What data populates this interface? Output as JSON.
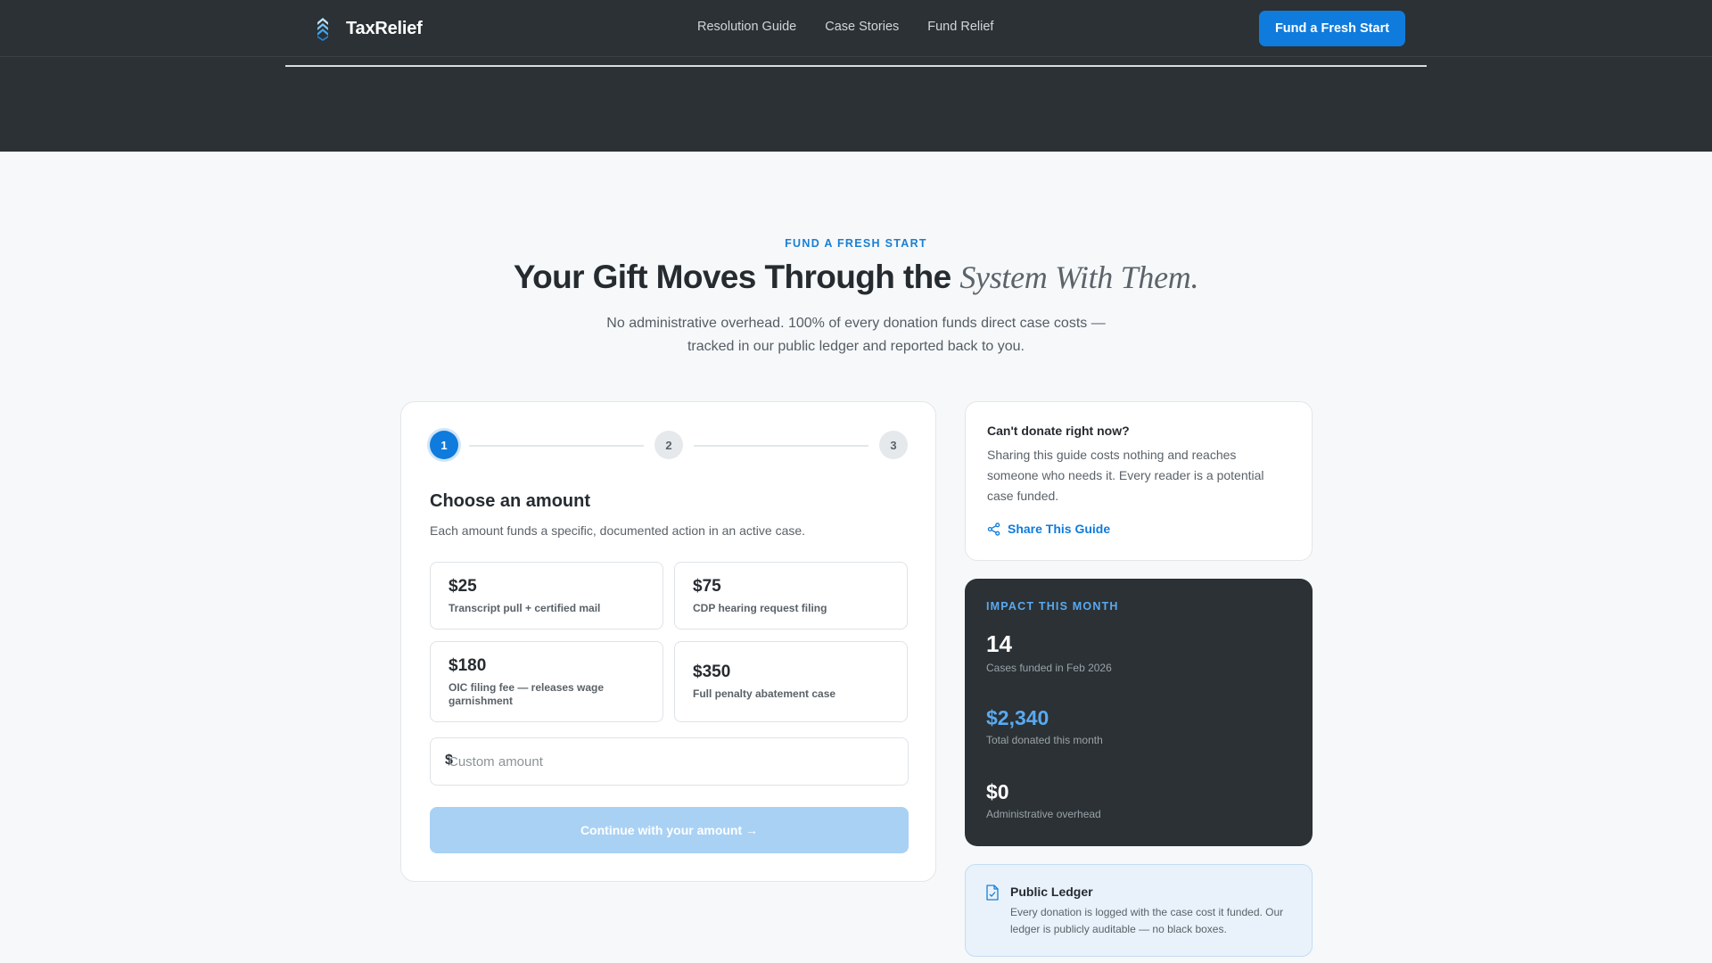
{
  "colors": {
    "header_bg": "#2b3134",
    "accent": "#0f7bdc",
    "accent_light": "#5aa9f0",
    "page_bg": "#f6f8fa",
    "button_disabled": "#a9d1f4"
  },
  "nav": {
    "brand": "TaxRelief",
    "brand_icon": "stacked-chevrons-icon",
    "links": [
      "Resolution Guide",
      "Case Stories",
      "Fund Relief"
    ],
    "cta": "Fund a Fresh Start"
  },
  "intro": {
    "eyebrow": "FUND A FRESH START",
    "headline_main": "Your Gift Moves Through the ",
    "headline_accent": "System With Them.",
    "subtext": "No administrative overhead. 100% of every donation funds direct case costs — tracked in our public ledger and reported back to you."
  },
  "donate": {
    "steps": [
      "1",
      "2",
      "3"
    ],
    "active_step": 1,
    "title": "Choose an amount",
    "description": "Each amount funds a specific, documented action in an active case.",
    "amounts": [
      {
        "value": "$25",
        "label": "Transcript pull + certified mail"
      },
      {
        "value": "$75",
        "label": "CDP hearing request filing"
      },
      {
        "value": "$180",
        "label": "OIC filing fee — releases wage garnishment"
      },
      {
        "value": "$350",
        "label": "Full penalty abatement case"
      }
    ],
    "custom_prefix": "$",
    "custom_placeholder": "Custom amount",
    "custom_value": "",
    "continue_label": "Continue with your amount →"
  },
  "share": {
    "title": "Can't donate right now?",
    "text": "Sharing this guide costs nothing and reaches someone who needs it. Every reader is a potential case funded.",
    "link": "Share This Guide",
    "icon": "share-icon"
  },
  "impact": {
    "heading": "IMPACT THIS MONTH",
    "stats": [
      {
        "value": "14",
        "label": "Cases funded in Feb 2026"
      },
      {
        "value": "$2,340",
        "label": "Total donated this month"
      },
      {
        "value": "$0",
        "label": "Administrative overhead"
      }
    ]
  },
  "ledger": {
    "icon": "document-icon",
    "title": "Public Ledger",
    "text": "Every donation is logged with the case cost it funded. Our ledger is publicly auditable — no black boxes."
  }
}
